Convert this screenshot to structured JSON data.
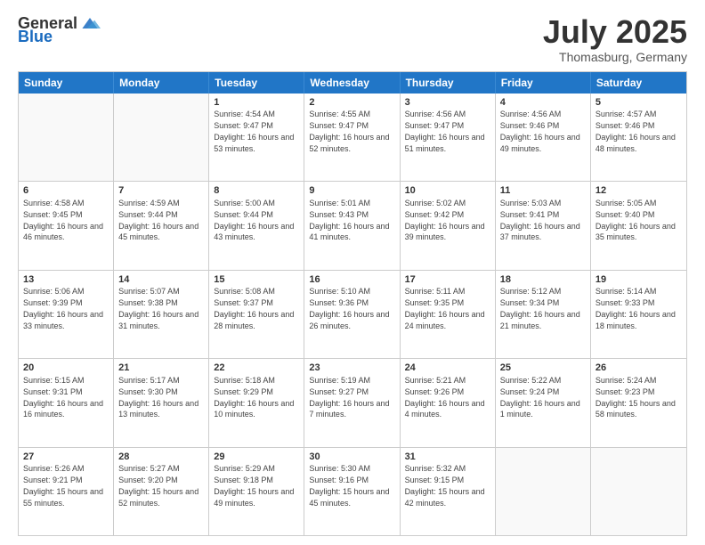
{
  "logo": {
    "general": "General",
    "blue": "Blue"
  },
  "title": "July 2025",
  "subtitle": "Thomasburg, Germany",
  "calendar": {
    "headers": [
      "Sunday",
      "Monday",
      "Tuesday",
      "Wednesday",
      "Thursday",
      "Friday",
      "Saturday"
    ],
    "rows": [
      [
        {
          "day": "",
          "text": ""
        },
        {
          "day": "",
          "text": ""
        },
        {
          "day": "1",
          "text": "Sunrise: 4:54 AM\nSunset: 9:47 PM\nDaylight: 16 hours and 53 minutes."
        },
        {
          "day": "2",
          "text": "Sunrise: 4:55 AM\nSunset: 9:47 PM\nDaylight: 16 hours and 52 minutes."
        },
        {
          "day": "3",
          "text": "Sunrise: 4:56 AM\nSunset: 9:47 PM\nDaylight: 16 hours and 51 minutes."
        },
        {
          "day": "4",
          "text": "Sunrise: 4:56 AM\nSunset: 9:46 PM\nDaylight: 16 hours and 49 minutes."
        },
        {
          "day": "5",
          "text": "Sunrise: 4:57 AM\nSunset: 9:46 PM\nDaylight: 16 hours and 48 minutes."
        }
      ],
      [
        {
          "day": "6",
          "text": "Sunrise: 4:58 AM\nSunset: 9:45 PM\nDaylight: 16 hours and 46 minutes."
        },
        {
          "day": "7",
          "text": "Sunrise: 4:59 AM\nSunset: 9:44 PM\nDaylight: 16 hours and 45 minutes."
        },
        {
          "day": "8",
          "text": "Sunrise: 5:00 AM\nSunset: 9:44 PM\nDaylight: 16 hours and 43 minutes."
        },
        {
          "day": "9",
          "text": "Sunrise: 5:01 AM\nSunset: 9:43 PM\nDaylight: 16 hours and 41 minutes."
        },
        {
          "day": "10",
          "text": "Sunrise: 5:02 AM\nSunset: 9:42 PM\nDaylight: 16 hours and 39 minutes."
        },
        {
          "day": "11",
          "text": "Sunrise: 5:03 AM\nSunset: 9:41 PM\nDaylight: 16 hours and 37 minutes."
        },
        {
          "day": "12",
          "text": "Sunrise: 5:05 AM\nSunset: 9:40 PM\nDaylight: 16 hours and 35 minutes."
        }
      ],
      [
        {
          "day": "13",
          "text": "Sunrise: 5:06 AM\nSunset: 9:39 PM\nDaylight: 16 hours and 33 minutes."
        },
        {
          "day": "14",
          "text": "Sunrise: 5:07 AM\nSunset: 9:38 PM\nDaylight: 16 hours and 31 minutes."
        },
        {
          "day": "15",
          "text": "Sunrise: 5:08 AM\nSunset: 9:37 PM\nDaylight: 16 hours and 28 minutes."
        },
        {
          "day": "16",
          "text": "Sunrise: 5:10 AM\nSunset: 9:36 PM\nDaylight: 16 hours and 26 minutes."
        },
        {
          "day": "17",
          "text": "Sunrise: 5:11 AM\nSunset: 9:35 PM\nDaylight: 16 hours and 24 minutes."
        },
        {
          "day": "18",
          "text": "Sunrise: 5:12 AM\nSunset: 9:34 PM\nDaylight: 16 hours and 21 minutes."
        },
        {
          "day": "19",
          "text": "Sunrise: 5:14 AM\nSunset: 9:33 PM\nDaylight: 16 hours and 18 minutes."
        }
      ],
      [
        {
          "day": "20",
          "text": "Sunrise: 5:15 AM\nSunset: 9:31 PM\nDaylight: 16 hours and 16 minutes."
        },
        {
          "day": "21",
          "text": "Sunrise: 5:17 AM\nSunset: 9:30 PM\nDaylight: 16 hours and 13 minutes."
        },
        {
          "day": "22",
          "text": "Sunrise: 5:18 AM\nSunset: 9:29 PM\nDaylight: 16 hours and 10 minutes."
        },
        {
          "day": "23",
          "text": "Sunrise: 5:19 AM\nSunset: 9:27 PM\nDaylight: 16 hours and 7 minutes."
        },
        {
          "day": "24",
          "text": "Sunrise: 5:21 AM\nSunset: 9:26 PM\nDaylight: 16 hours and 4 minutes."
        },
        {
          "day": "25",
          "text": "Sunrise: 5:22 AM\nSunset: 9:24 PM\nDaylight: 16 hours and 1 minute."
        },
        {
          "day": "26",
          "text": "Sunrise: 5:24 AM\nSunset: 9:23 PM\nDaylight: 15 hours and 58 minutes."
        }
      ],
      [
        {
          "day": "27",
          "text": "Sunrise: 5:26 AM\nSunset: 9:21 PM\nDaylight: 15 hours and 55 minutes."
        },
        {
          "day": "28",
          "text": "Sunrise: 5:27 AM\nSunset: 9:20 PM\nDaylight: 15 hours and 52 minutes."
        },
        {
          "day": "29",
          "text": "Sunrise: 5:29 AM\nSunset: 9:18 PM\nDaylight: 15 hours and 49 minutes."
        },
        {
          "day": "30",
          "text": "Sunrise: 5:30 AM\nSunset: 9:16 PM\nDaylight: 15 hours and 45 minutes."
        },
        {
          "day": "31",
          "text": "Sunrise: 5:32 AM\nSunset: 9:15 PM\nDaylight: 15 hours and 42 minutes."
        },
        {
          "day": "",
          "text": ""
        },
        {
          "day": "",
          "text": ""
        }
      ]
    ]
  }
}
